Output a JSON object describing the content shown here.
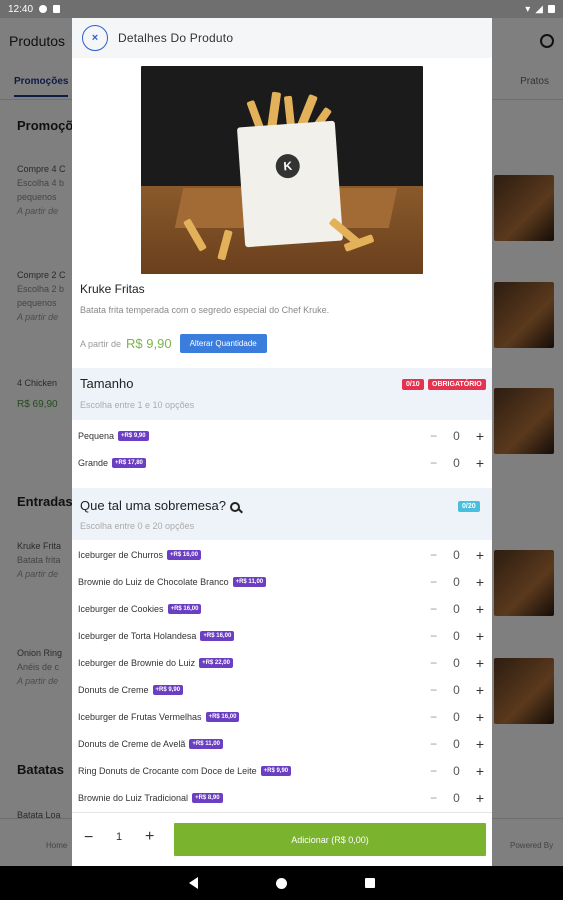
{
  "status_bar": {
    "time": "12:40"
  },
  "background_app": {
    "header_title": "Produtos",
    "tabs": [
      "Promoções",
      "Pratos"
    ],
    "sections": [
      "Promoções",
      "Entradas",
      "Batatas"
    ],
    "items": [
      {
        "name": "Compre 4 C",
        "desc": "Escolha 4 b",
        "desc2": "pequenos",
        "price": "A partir de"
      },
      {
        "name": "Compre 2 C",
        "desc": "Escolha 2 b",
        "desc2": "pequenos",
        "price": "A partir de"
      },
      {
        "name": "4 Chicken",
        "price": "R$ 69,90"
      },
      {
        "name": "Kruke Frita",
        "desc": "Batata frita",
        "price": "A partir de"
      },
      {
        "name": "Onion Ring",
        "desc": "Anéis de c",
        "price": "A partir de"
      },
      {
        "name": "Batata Loa"
      }
    ],
    "bottom_nav": {
      "home": "Home",
      "right_label": "Powered By"
    }
  },
  "modal": {
    "close_label": "×",
    "title": "Detalhes Do Produto",
    "product": {
      "name": "Kruke Fritas",
      "description": "Batata frita temperada com o segredo especial do Chef Kruke.",
      "price_prefix": "A partir de",
      "price": "R$ 9,90",
      "change_qty_label": "Alterar Quantidade"
    },
    "groups": [
      {
        "title": "Tamanho",
        "subtitle": "Escolha entre 1 e 10 opções",
        "count_badge": "0/10",
        "required_badge": "OBRIGATÓRIO",
        "options": [
          {
            "name": "Pequena",
            "price": "+R$ 9,90",
            "qty": "0"
          },
          {
            "name": "Grande",
            "price": "+R$ 17,80",
            "qty": "0"
          }
        ]
      },
      {
        "title": "Que tal uma sobremesa?",
        "subtitle": "Escolha entre 0 e 20 opções",
        "count_badge": "0/20",
        "options": [
          {
            "name": "Iceburger de Churros",
            "price": "+R$ 16,00",
            "qty": "0"
          },
          {
            "name": "Brownie do Luiz de Chocolate Branco",
            "price": "+R$ 11,00",
            "qty": "0"
          },
          {
            "name": "Iceburger de Cookies",
            "price": "+R$ 16,00",
            "qty": "0"
          },
          {
            "name": "Iceburger de Torta Holandesa",
            "price": "+R$ 16,00",
            "qty": "0"
          },
          {
            "name": "Iceburger de Brownie do Luiz",
            "price": "+R$ 22,00",
            "qty": "0"
          },
          {
            "name": "Donuts de Creme",
            "price": "+R$ 9,90",
            "qty": "0"
          },
          {
            "name": "Iceburger de Frutas Vermelhas",
            "price": "+R$ 16,00",
            "qty": "0"
          },
          {
            "name": "Donuts de Creme de Avelã",
            "price": "+R$ 11,00",
            "qty": "0"
          },
          {
            "name": "Ring Donuts de Crocante com Doce de Leite",
            "price": "+R$ 9,90",
            "qty": "0"
          },
          {
            "name": "Brownie do Luiz Tradicional",
            "price": "+R$ 8,90",
            "qty": "0"
          }
        ]
      }
    ],
    "bottom": {
      "minus": "−",
      "quantity": "1",
      "plus": "+",
      "add_label": "Adicionar (R$ 0,00)"
    },
    "stepper_minus": "−",
    "stepper_plus": "+"
  },
  "colors": {
    "accent": "#3b7ddd",
    "price_green": "#7ab648",
    "add_button": "#7ab32e",
    "price_badge": "#6a3fc1",
    "required": "#e5334f"
  }
}
